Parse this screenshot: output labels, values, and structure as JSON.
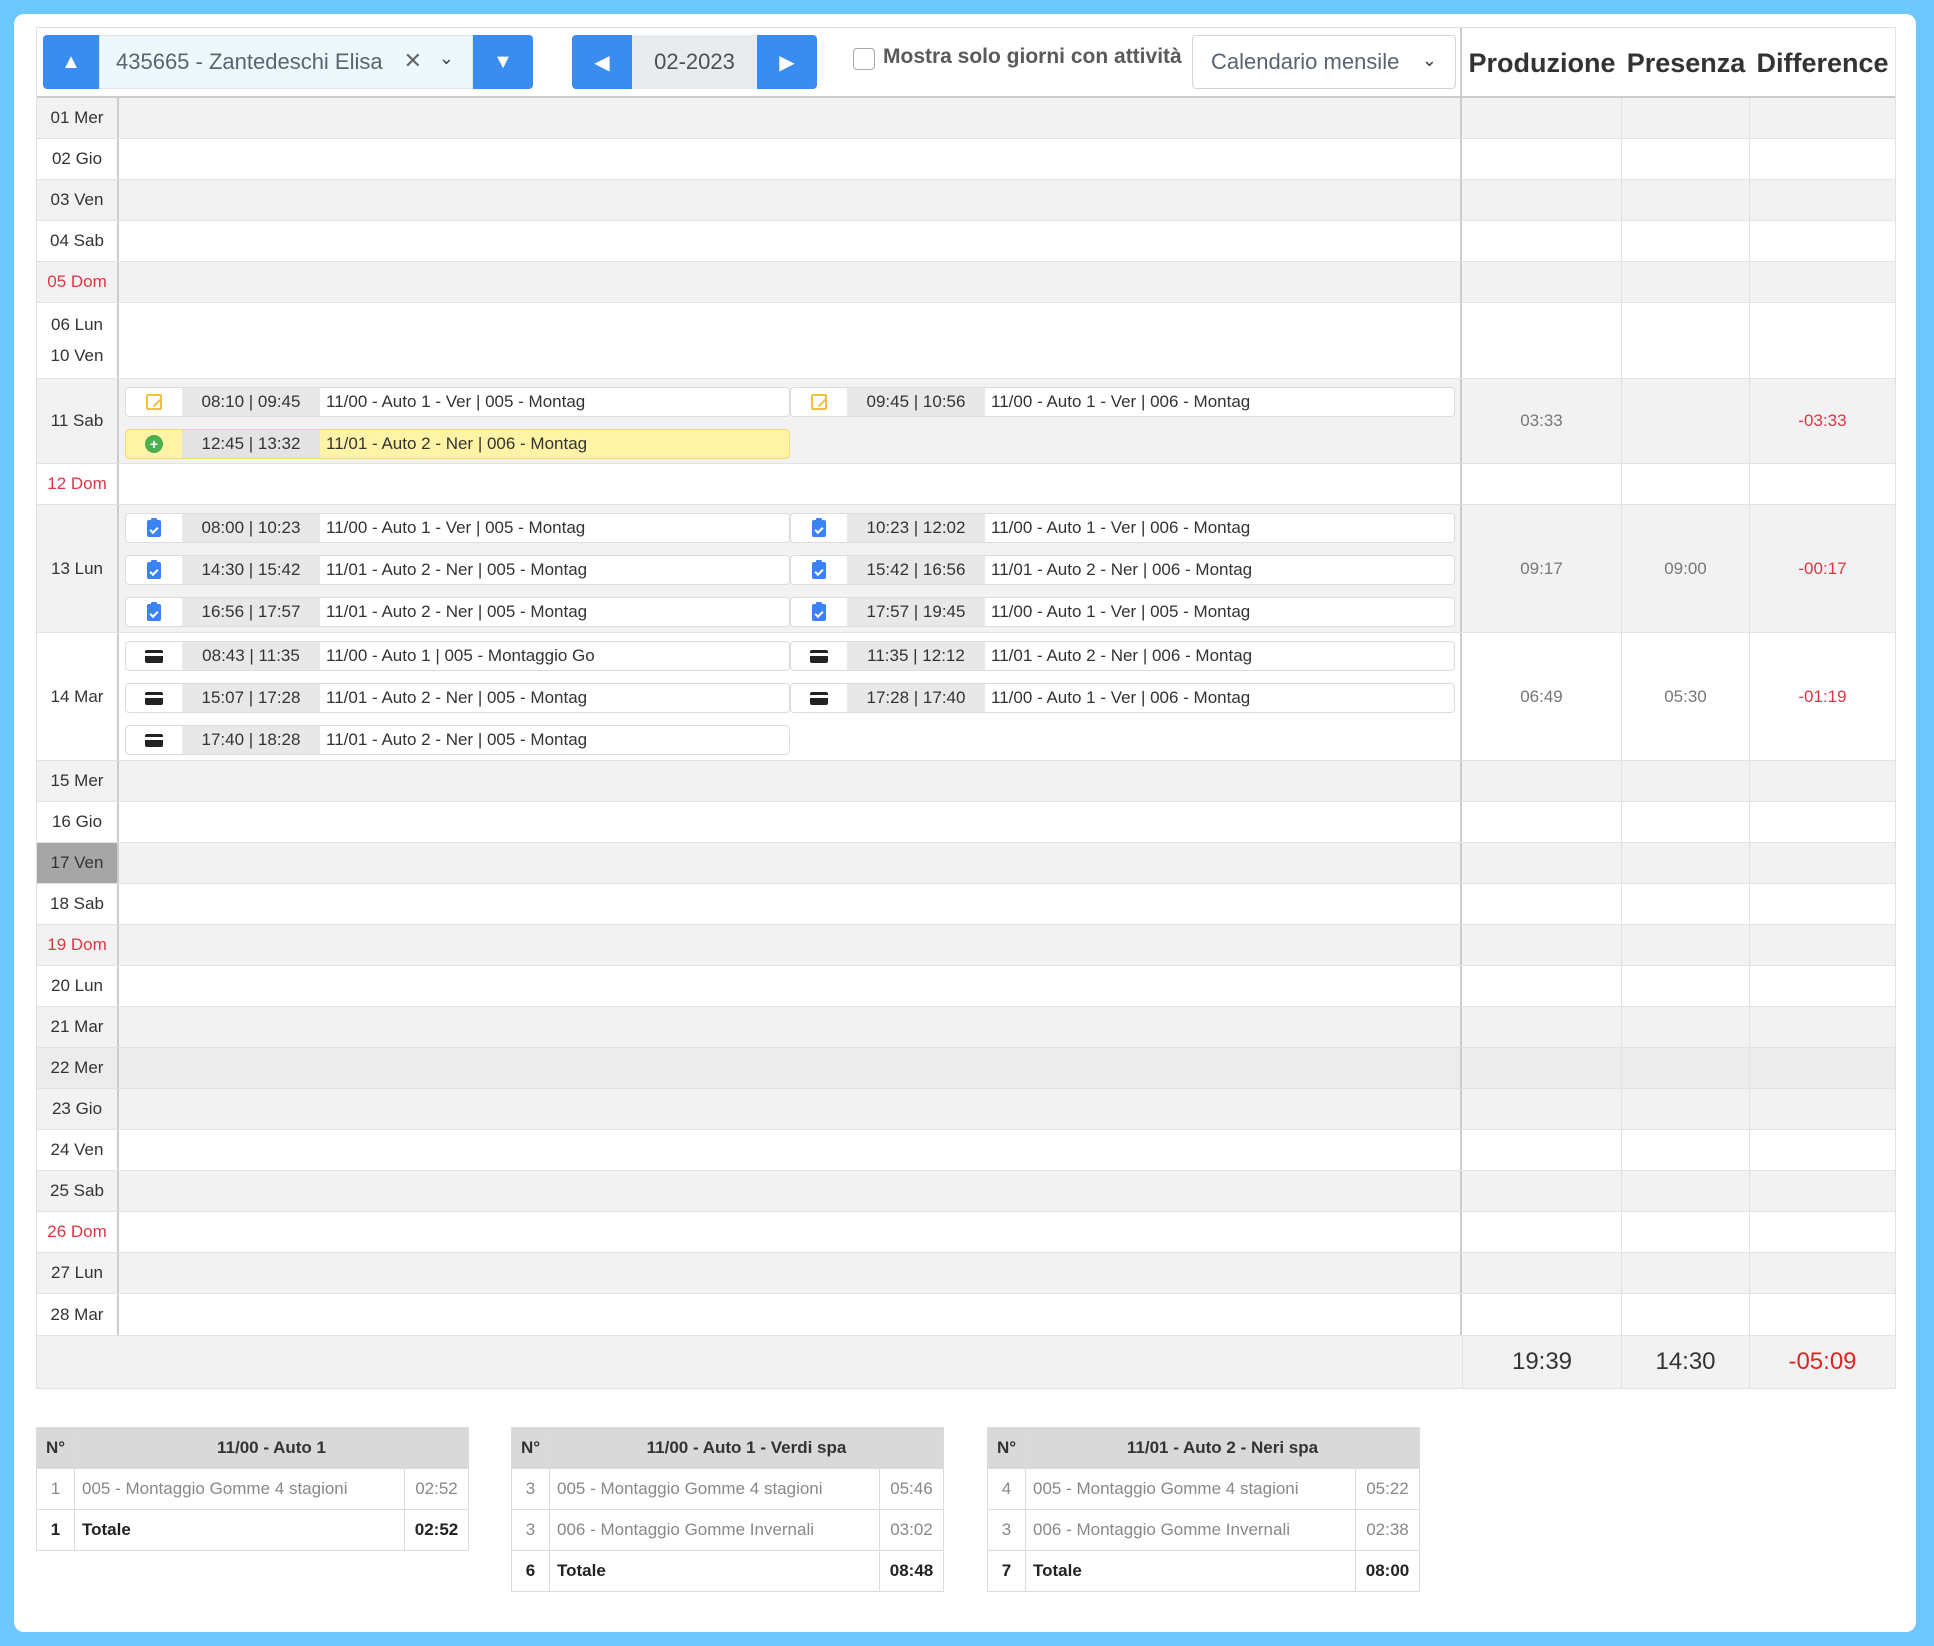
{
  "header": {
    "employee": "435665 - Zantedeschi Elisa",
    "month": "02-2023",
    "only_activity_label": "Mostra solo giorni con attività",
    "view_select": "Calendario mensile",
    "col_production": "Produzione",
    "col_presence": "Presenza",
    "col_difference": "Difference"
  },
  "days": [
    {
      "label": "01 Mer"
    },
    {
      "label": "02 Gio"
    },
    {
      "label": "03 Ven"
    },
    {
      "label": "04 Sab"
    },
    {
      "label": "05 Dom"
    },
    {
      "label": "06 Lun",
      "label2": "10 Ven"
    },
    {
      "label": "11 Sab",
      "prod": "03:33",
      "pres": "",
      "diff": "-03:33"
    },
    {
      "label": "12 Dom"
    },
    {
      "label": "13 Lun",
      "prod": "09:17",
      "pres": "09:00",
      "diff": "-00:17"
    },
    {
      "label": "14 Mar",
      "prod": "06:49",
      "pres": "05:30",
      "diff": "-01:19"
    },
    {
      "label": "15 Mer"
    },
    {
      "label": "16 Gio"
    },
    {
      "label": "17 Ven"
    },
    {
      "label": "18 Sab"
    },
    {
      "label": "19 Dom"
    },
    {
      "label": "20 Lun"
    },
    {
      "label": "21 Mar"
    },
    {
      "label": "22 Mer"
    },
    {
      "label": "23 Gio"
    },
    {
      "label": "24 Ven"
    },
    {
      "label": "25 Sab"
    },
    {
      "label": "26 Dom"
    },
    {
      "label": "27 Lun"
    },
    {
      "label": "28 Mar"
    }
  ],
  "activities": {
    "d11": [
      {
        "icon": "note-icon",
        "time": "08:10 | 09:45",
        "text": "11/00 - Auto 1 - Ver | 005 - Montag"
      },
      {
        "icon": "note-icon",
        "time": "09:45 | 10:56",
        "text": "11/00 - Auto 1 - Ver | 006 - Montag"
      },
      {
        "icon": "plus-circle-icon",
        "time": "12:45 | 13:32",
        "text": "11/01 - Auto 2 - Ner | 006 - Montag",
        "highlight": true
      }
    ],
    "d13": [
      {
        "icon": "clipboard-check-icon",
        "time": "08:00 | 10:23",
        "text": "11/00 - Auto 1 - Ver | 005 - Montag"
      },
      {
        "icon": "clipboard-check-icon",
        "time": "10:23 | 12:02",
        "text": "11/00 - Auto 1 - Ver | 006 - Montag"
      },
      {
        "icon": "clipboard-check-icon",
        "time": "14:30 | 15:42",
        "text": "11/01 - Auto 2 - Ner | 005 - Montag"
      },
      {
        "icon": "clipboard-check-icon",
        "time": "15:42 | 16:56",
        "text": "11/01 - Auto 2 - Ner | 006 - Montag"
      },
      {
        "icon": "clipboard-check-icon",
        "time": "16:56 | 17:57",
        "text": "11/01 - Auto 2 - Ner | 005 - Montag"
      },
      {
        "icon": "clipboard-check-icon",
        "time": "17:57 | 19:45",
        "text": "11/00 - Auto 1 - Ver | 005 - Montag"
      }
    ],
    "d14": [
      {
        "icon": "card-icon",
        "time": "08:43 | 11:35",
        "text": "11/00 - Auto 1 | 005 - Montaggio Go"
      },
      {
        "icon": "card-icon",
        "time": "11:35 | 12:12",
        "text": "11/01 - Auto 2 - Ner | 006 - Montag"
      },
      {
        "icon": "card-icon",
        "time": "15:07 | 17:28",
        "text": "11/01 - Auto 2 - Ner | 005 - Montag"
      },
      {
        "icon": "card-icon",
        "time": "17:28 | 17:40",
        "text": "11/00 - Auto 1 - Ver | 006 - Montag"
      },
      {
        "icon": "card-icon",
        "time": "17:40 | 18:28",
        "text": "11/01 - Auto 2 - Ner | 005 - Montag"
      }
    ]
  },
  "totals": {
    "prod": "19:39",
    "pres": "14:30",
    "diff": "-05:09"
  },
  "summaries": [
    {
      "num_header": "N°",
      "title": "11/00 - Auto 1",
      "rows": [
        {
          "n": "1",
          "label": "005 - Montaggio Gomme 4 stagioni",
          "value": "02:52"
        }
      ],
      "total": {
        "n": "1",
        "label": "Totale",
        "value": "02:52"
      }
    },
    {
      "num_header": "N°",
      "title": "11/00 - Auto 1 - Verdi spa",
      "rows": [
        {
          "n": "3",
          "label": "005 - Montaggio Gomme 4 stagioni",
          "value": "05:46"
        },
        {
          "n": "3",
          "label": "006 - Montaggio Gomme Invernali",
          "value": "03:02"
        }
      ],
      "total": {
        "n": "6",
        "label": "Totale",
        "value": "08:48"
      }
    },
    {
      "num_header": "N°",
      "title": "11/01 - Auto 2 - Neri spa",
      "rows": [
        {
          "n": "4",
          "label": "005 - Montaggio Gomme 4 stagioni",
          "value": "05:22"
        },
        {
          "n": "3",
          "label": "006 - Montaggio Gomme Invernali",
          "value": "02:38"
        }
      ],
      "total": {
        "n": "7",
        "label": "Totale",
        "value": "08:00"
      }
    }
  ],
  "colors": {
    "accent": "#3b8cf0",
    "background": "#6cc8ff",
    "negative": "#dc3545",
    "highlight": "#fff3a6"
  }
}
